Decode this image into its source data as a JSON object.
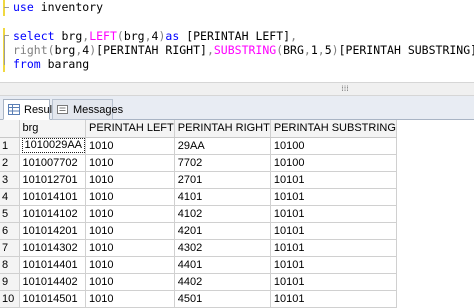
{
  "editor": {
    "lines": [
      {
        "parts": [
          {
            "t": "use ",
            "c": "kw"
          },
          {
            "t": "inventory",
            "c": ""
          }
        ]
      },
      {
        "parts": []
      },
      {
        "parts": [
          {
            "t": "select ",
            "c": "kw"
          },
          {
            "t": "brg",
            "c": ""
          },
          {
            "t": ",",
            "c": "gr"
          },
          {
            "t": "LEFT",
            "c": "fn"
          },
          {
            "t": "(",
            "c": "gr"
          },
          {
            "t": "brg",
            "c": ""
          },
          {
            "t": ",",
            "c": "gr"
          },
          {
            "t": "4",
            "c": ""
          },
          {
            "t": ")",
            "c": "gr"
          },
          {
            "t": "as ",
            "c": "kw"
          },
          {
            "t": "[PERINTAH LEFT]",
            "c": ""
          },
          {
            "t": ",",
            "c": "gr"
          }
        ]
      },
      {
        "parts": [
          {
            "t": "right",
            "c": "gr"
          },
          {
            "t": "(",
            "c": "gr"
          },
          {
            "t": "brg",
            "c": ""
          },
          {
            "t": ",",
            "c": "gr"
          },
          {
            "t": "4",
            "c": ""
          },
          {
            "t": ")",
            "c": "gr"
          },
          {
            "t": "[PERINTAH RIGHT]",
            "c": ""
          },
          {
            "t": ",",
            "c": "gr"
          },
          {
            "t": "SUBSTRING",
            "c": "fn"
          },
          {
            "t": "(",
            "c": "gr"
          },
          {
            "t": "BRG",
            "c": ""
          },
          {
            "t": ",",
            "c": "gr"
          },
          {
            "t": "1",
            "c": ""
          },
          {
            "t": ",",
            "c": "gr"
          },
          {
            "t": "5",
            "c": ""
          },
          {
            "t": ")",
            "c": "gr"
          },
          {
            "t": "[PERINTAH SUBSTRING]",
            "c": ""
          }
        ]
      },
      {
        "parts": [
          {
            "t": "from ",
            "c": "kw"
          },
          {
            "t": "barang",
            "c": ""
          }
        ]
      }
    ]
  },
  "tabs": {
    "results": "Results",
    "messages": "Messages"
  },
  "grid": {
    "columns": [
      "brg",
      "PERINTAH LEFT",
      "PERINTAH RIGHT",
      "PERINTAH SUBSTRING"
    ],
    "rows": [
      {
        "num": "1",
        "cells": [
          "1010029AA",
          "1010",
          "29AA",
          "10100"
        ]
      },
      {
        "num": "2",
        "cells": [
          "101007702",
          "1010",
          "7702",
          "10100"
        ]
      },
      {
        "num": "3",
        "cells": [
          "101012701",
          "1010",
          "2701",
          "10101"
        ]
      },
      {
        "num": "4",
        "cells": [
          "101014101",
          "1010",
          "4101",
          "10101"
        ]
      },
      {
        "num": "5",
        "cells": [
          "101014102",
          "1010",
          "4102",
          "10101"
        ]
      },
      {
        "num": "6",
        "cells": [
          "101014201",
          "1010",
          "4201",
          "10101"
        ]
      },
      {
        "num": "7",
        "cells": [
          "101014302",
          "1010",
          "4302",
          "10101"
        ]
      },
      {
        "num": "8",
        "cells": [
          "101014401",
          "1010",
          "4401",
          "10101"
        ]
      },
      {
        "num": "9",
        "cells": [
          "101014402",
          "1010",
          "4402",
          "10101"
        ]
      },
      {
        "num": "10",
        "cells": [
          "101014501",
          "1010",
          "4501",
          "10101"
        ]
      }
    ]
  },
  "colors": {
    "keyword": "#0000ff",
    "function": "#ff00ff",
    "operator": "#808080"
  }
}
